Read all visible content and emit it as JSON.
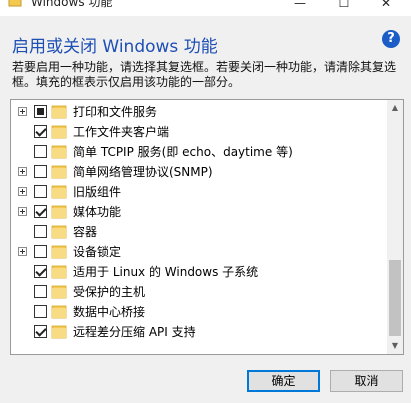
{
  "window": {
    "title": "Windows 功能",
    "controls": {
      "minimize": "—",
      "maximize": "☐",
      "close": "✕"
    }
  },
  "heading": "启用或关闭 Windows 功能",
  "help_icon": "?",
  "description": "若要启用一种功能，请选择其复选框。若要关闭一种功能，请清除其复选框。填充的框表示仅启用该功能的一部分。",
  "features": [
    {
      "label": "打印和文件服务",
      "expandable": true,
      "state": "partial"
    },
    {
      "label": "工作文件夹客户端",
      "expandable": false,
      "state": "checked"
    },
    {
      "label": "简单 TCPIP 服务(即 echo、daytime 等)",
      "expandable": false,
      "state": "unchecked"
    },
    {
      "label": "简单网络管理协议(SNMP)",
      "expandable": true,
      "state": "unchecked"
    },
    {
      "label": "旧版组件",
      "expandable": true,
      "state": "unchecked"
    },
    {
      "label": "媒体功能",
      "expandable": true,
      "state": "checked"
    },
    {
      "label": "容器",
      "expandable": false,
      "state": "unchecked"
    },
    {
      "label": "设备锁定",
      "expandable": true,
      "state": "unchecked"
    },
    {
      "label": "适用于 Linux 的 Windows 子系统",
      "expandable": false,
      "state": "checked"
    },
    {
      "label": "受保护的主机",
      "expandable": false,
      "state": "unchecked"
    },
    {
      "label": "数据中心桥接",
      "expandable": false,
      "state": "unchecked"
    },
    {
      "label": "远程差分压缩 API 支持",
      "expandable": false,
      "state": "checked"
    }
  ],
  "buttons": {
    "ok": "确定",
    "cancel": "取消"
  },
  "colors": {
    "heading": "#1e4fb5",
    "folder": "#f3c94f",
    "accent": "#0078d7"
  }
}
